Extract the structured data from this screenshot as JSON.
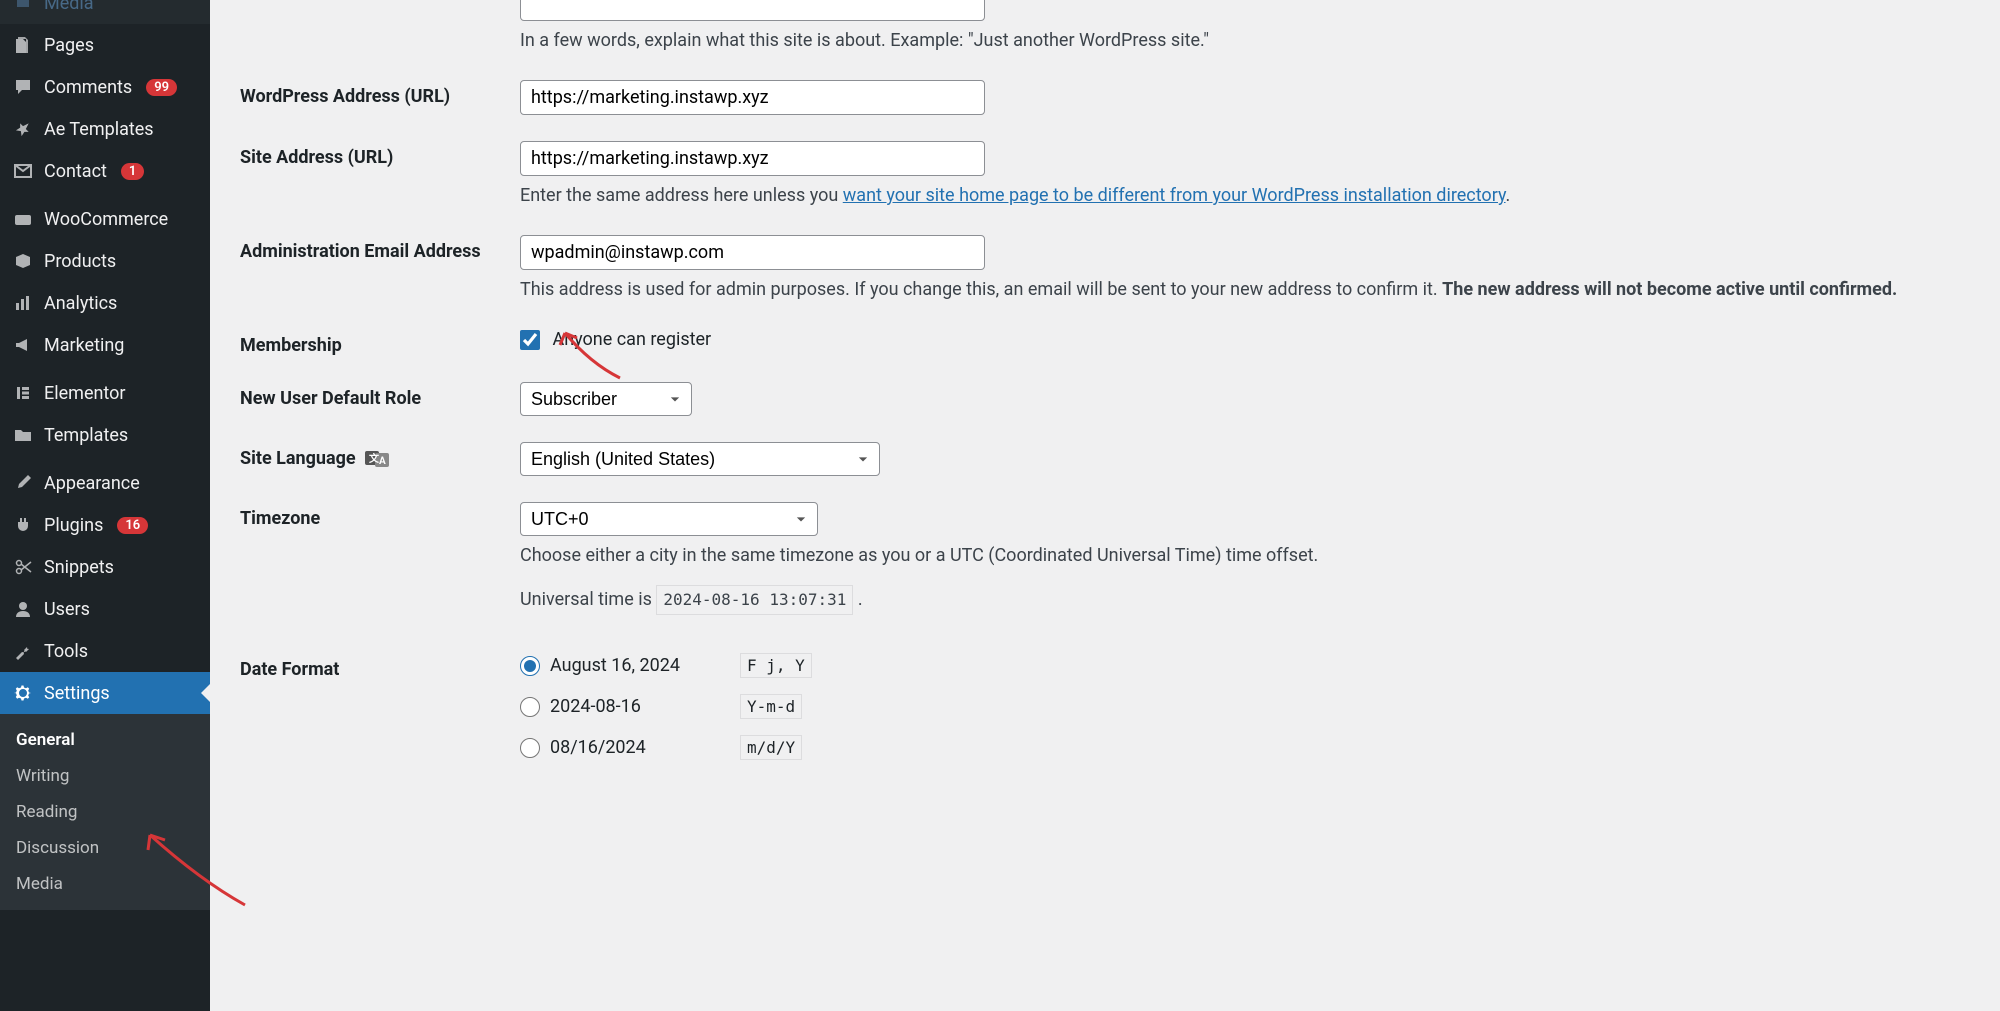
{
  "sidebar": {
    "items": [
      {
        "label": "Media",
        "icon": "media"
      },
      {
        "label": "Pages",
        "icon": "pages"
      },
      {
        "label": "Comments",
        "icon": "comments",
        "badge": "99"
      },
      {
        "label": "Ae Templates",
        "icon": "pin"
      },
      {
        "label": "Contact",
        "icon": "mail",
        "badge": "1"
      },
      {
        "label": "WooCommerce",
        "icon": "woo"
      },
      {
        "label": "Products",
        "icon": "box"
      },
      {
        "label": "Analytics",
        "icon": "chart"
      },
      {
        "label": "Marketing",
        "icon": "megaphone"
      },
      {
        "label": "Elementor",
        "icon": "elementor"
      },
      {
        "label": "Templates",
        "icon": "folder"
      },
      {
        "label": "Appearance",
        "icon": "brush"
      },
      {
        "label": "Plugins",
        "icon": "plug",
        "badge": "16"
      },
      {
        "label": "Snippets",
        "icon": "scissors"
      },
      {
        "label": "Users",
        "icon": "user"
      },
      {
        "label": "Tools",
        "icon": "wrench"
      },
      {
        "label": "Settings",
        "icon": "gear"
      }
    ],
    "submenu": [
      {
        "label": "General"
      },
      {
        "label": "Writing"
      },
      {
        "label": "Reading"
      },
      {
        "label": "Discussion"
      },
      {
        "label": "Media"
      }
    ]
  },
  "form": {
    "tagline_desc": "In a few words, explain what this site is about. Example: \"Just another WordPress site.\"",
    "wp_address_label": "WordPress Address (URL)",
    "wp_address_value": "https://marketing.instawp.xyz",
    "site_address_label": "Site Address (URL)",
    "site_address_value": "https://marketing.instawp.xyz",
    "site_address_desc_pre": "Enter the same address here unless you ",
    "site_address_link": "want your site home page to be different from your WordPress installation directory",
    "site_address_desc_post": ".",
    "admin_email_label": "Administration Email Address",
    "admin_email_value": "wpadmin@instawp.com",
    "admin_email_desc_pre": "This address is used for admin purposes. If you change this, an email will be sent to your new address to confirm it. ",
    "admin_email_desc_bold": "The new address will not become active until confirmed.",
    "membership_label": "Membership",
    "membership_checkbox_label": "Anyone can register",
    "role_label": "New User Default Role",
    "role_value": "Subscriber",
    "lang_label": "Site Language",
    "lang_value": "English (United States)",
    "tz_label": "Timezone",
    "tz_value": "UTC+0",
    "tz_desc": "Choose either a city in the same timezone as you or a UTC (Coordinated Universal Time) time offset.",
    "utime_pre": "Universal time is ",
    "utime_code": "2024-08-16 13:07:31",
    "utime_post": " .",
    "date_format_label": "Date Format",
    "date_formats": [
      {
        "display": "August 16, 2024",
        "code": "F j, Y",
        "checked": true
      },
      {
        "display": "2024-08-16",
        "code": "Y-m-d",
        "checked": false
      },
      {
        "display": "08/16/2024",
        "code": "m/d/Y",
        "checked": false
      }
    ]
  }
}
